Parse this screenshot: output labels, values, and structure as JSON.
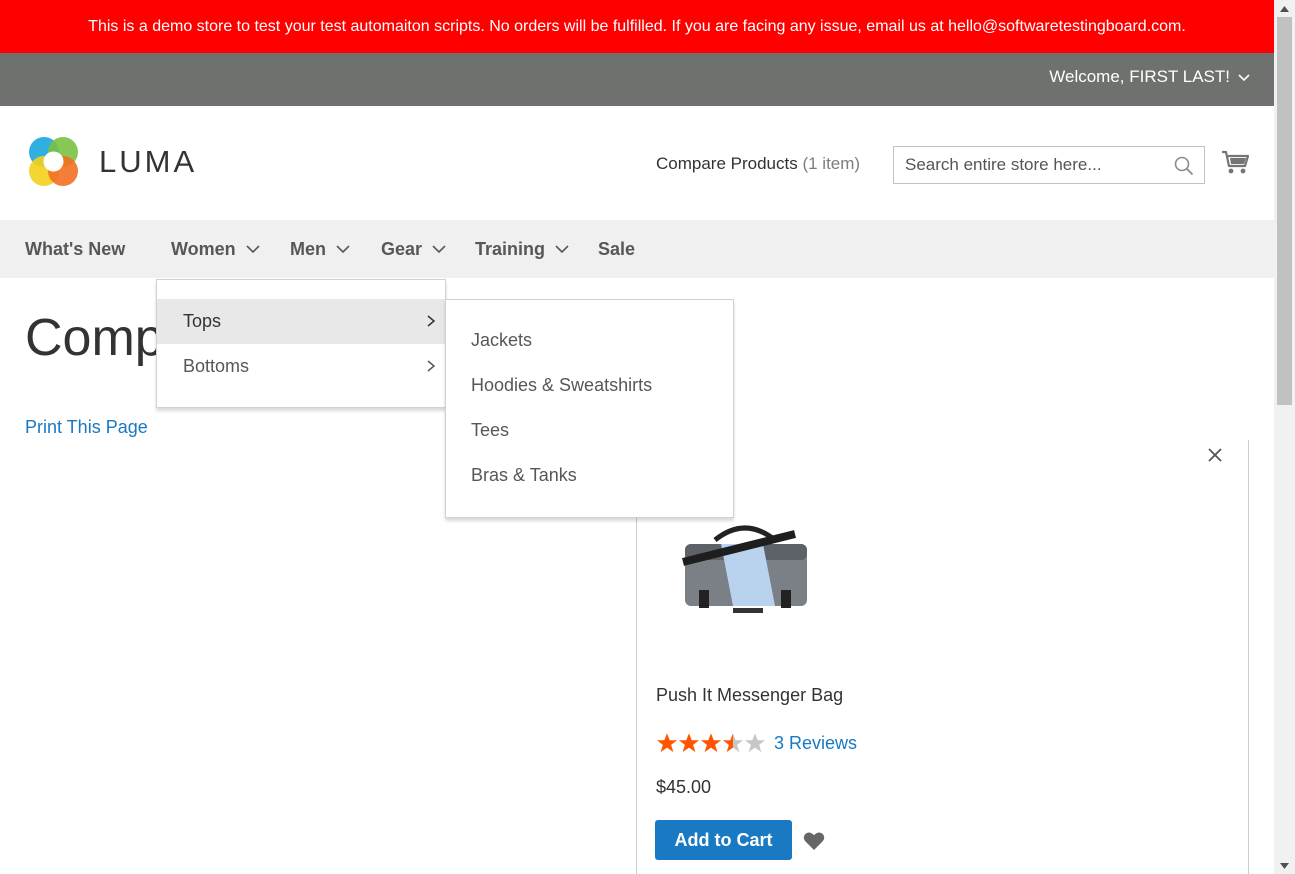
{
  "demo_bar": {
    "text": "This is a demo store to test your test automaiton scripts. No orders will be fulfilled. If you are facing any issue, email us at hello@softwaretestingboard.com."
  },
  "header": {
    "welcome": "Welcome, FIRST LAST!",
    "logo_text": "LUMA",
    "compare_label": "Compare Products",
    "compare_count": "(1 item)",
    "search_placeholder": "Search entire store here..."
  },
  "nav": {
    "items": [
      {
        "label": "What's New"
      },
      {
        "label": "Women"
      },
      {
        "label": "Men"
      },
      {
        "label": "Gear"
      },
      {
        "label": "Training"
      },
      {
        "label": "Sale"
      }
    ]
  },
  "dropdown": {
    "level1": [
      {
        "label": "Tops",
        "active": true
      },
      {
        "label": "Bottoms",
        "active": false
      }
    ],
    "level2": [
      {
        "label": "Jackets"
      },
      {
        "label": "Hoodies & Sweatshirts"
      },
      {
        "label": "Tees"
      },
      {
        "label": "Bras & Tanks"
      }
    ]
  },
  "main": {
    "title": "Comp",
    "print_link": "Print This Page"
  },
  "product": {
    "name": "Push It Messenger Bag",
    "rating_stars": 3.5,
    "rating_max": 5,
    "reviews": "3 Reviews",
    "price": "$45.00",
    "add_to_cart": "Add to Cart"
  },
  "colors": {
    "demo_bar": "#ff0000",
    "header_top": "#6e716e",
    "link": "#1979c3",
    "button": "#1979c3",
    "star_on": "#ff5501",
    "star_off": "#c7c7c7"
  },
  "icons": {
    "search": "search-icon",
    "cart": "cart-icon",
    "remove": "close-icon",
    "wishlist": "heart-icon",
    "chevron": "chevron-down-icon"
  }
}
